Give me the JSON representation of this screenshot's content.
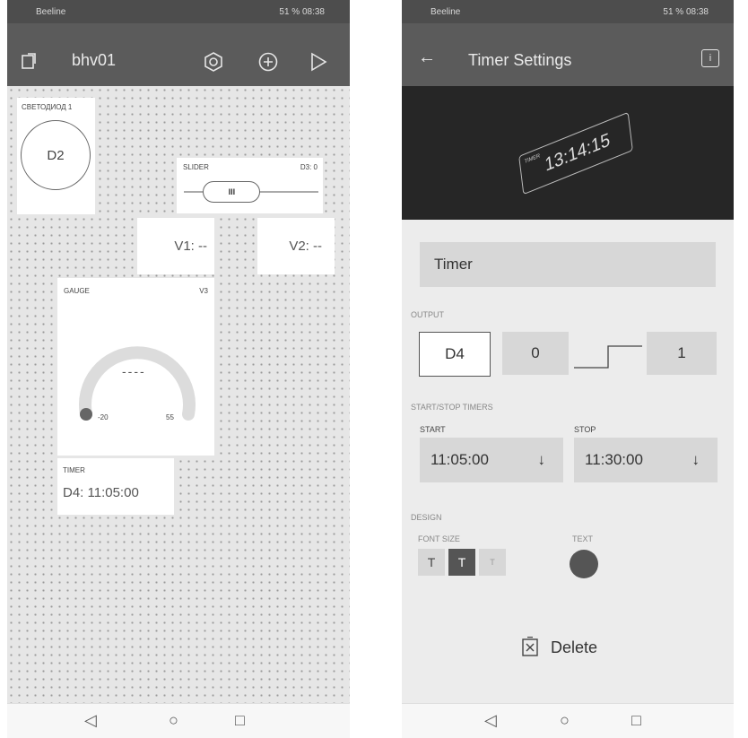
{
  "left": {
    "status": {
      "carrier": "Beeline",
      "battery": "51 %",
      "time": "08:38"
    },
    "header": {
      "title": "bhv01",
      "icons": [
        "device-add-icon",
        "settings-hex-icon",
        "add-circle-icon",
        "play-icon"
      ]
    },
    "button_widget": {
      "label": "СВЕТОДИОД 1",
      "pin": "D2"
    },
    "slider_widget": {
      "label": "SLIDER",
      "pin_value": "D3: 0",
      "thumb": "III",
      "level": 0.3
    },
    "value1": {
      "text": "V1: --"
    },
    "value2": {
      "text": "V2: --"
    },
    "gauge_widget": {
      "label": "GAUGE",
      "pin": "V3",
      "value": "----",
      "min": "-20",
      "max": "55"
    },
    "timer_widget": {
      "label": "TIMER",
      "value": "D4: 11:05:00"
    }
  },
  "right": {
    "status": {
      "carrier": "Beeline",
      "battery": "51 %",
      "time": "08:38"
    },
    "header": {
      "title": "Timer Settings",
      "back": "←",
      "info": "i"
    },
    "illustration": {
      "label": "TIMER",
      "time": "13:14:15"
    },
    "name_field": "Timer",
    "output": {
      "label": "OUTPUT",
      "pin": "D4",
      "low": "0",
      "high": "1"
    },
    "timers": {
      "label": "START/STOP TIMERS",
      "start_label": "START",
      "start_value": "11:05:00",
      "stop_label": "STOP",
      "stop_value": "11:30:00",
      "arrow": "↓"
    },
    "design": {
      "label": "DESIGN",
      "font_size_label": "FONT SIZE",
      "font_sizes": [
        "T",
        "T",
        "T"
      ],
      "text_label": "TEXT",
      "text_color": "#555555"
    },
    "delete_label": "Delete"
  },
  "nav": {
    "back": "◁",
    "home": "○",
    "recent": "□"
  }
}
